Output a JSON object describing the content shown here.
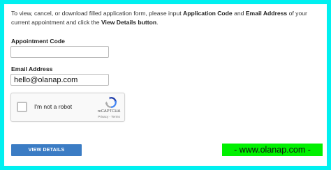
{
  "intro": {
    "part1": "To view, cancel, or download filled application form, please input ",
    "bold1": "Application Code",
    "part2": " and ",
    "bold2": "Email Address",
    "part3": " of your current appointment and click the ",
    "bold3": "View Details button",
    "part4": "."
  },
  "appointment_code": {
    "label": "Appointment Code",
    "value": ""
  },
  "email": {
    "label": "Email Address",
    "value": "hello@olanap.com"
  },
  "recaptcha": {
    "checkbox_label": "I'm not a robot",
    "brand": "reCAPTCHA",
    "links": "Privacy - Terms"
  },
  "view_details_button": "VIEW DETAILS",
  "watermark": "- www.olanap.com -",
  "colors": {
    "page_border": "#00f0f0",
    "button": "#3b7cc4",
    "watermark_bg": "#00f000"
  }
}
